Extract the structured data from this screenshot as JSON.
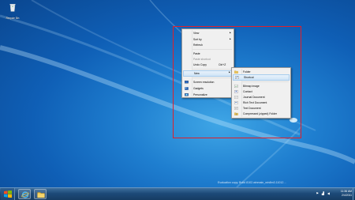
{
  "desktop": {
    "icons": [
      {
        "label": "Recycle Bin",
        "icon": "recycle-bin-icon"
      }
    ],
    "watermark": "Evaluation copy. Build 8102.winmain_win8m3.11012…"
  },
  "context_menu": {
    "items": [
      {
        "label": "View",
        "submenu": true
      },
      {
        "label": "Sort by",
        "submenu": true
      },
      {
        "label": "Refresh"
      },
      {
        "label": "Paste"
      },
      {
        "label": "Paste shortcut",
        "disabled": true
      },
      {
        "label": "Undo Copy",
        "shortcut": "Ctrl+Z"
      },
      {
        "label": "New",
        "submenu": true,
        "active": true
      },
      {
        "label": "Screen resolution",
        "icon": "screen-resolution-icon"
      },
      {
        "label": "Gadgets",
        "icon": "gadgets-icon"
      },
      {
        "label": "Personalize",
        "icon": "personalize-icon"
      }
    ]
  },
  "new_submenu": {
    "items": [
      {
        "label": "Folder",
        "icon": "folder-icon"
      },
      {
        "label": "Shortcut",
        "icon": "shortcut-icon",
        "active": true
      },
      {
        "label": "Bitmap image",
        "icon": "bitmap-image-icon"
      },
      {
        "label": "Contact",
        "icon": "contact-icon"
      },
      {
        "label": "Journal Document",
        "icon": "journal-document-icon"
      },
      {
        "label": "Rich Text Document",
        "icon": "rich-text-document-icon"
      },
      {
        "label": "Text Document",
        "icon": "text-document-icon"
      },
      {
        "label": "Compressed (zipped) Folder",
        "icon": "compressed-folder-icon"
      }
    ]
  },
  "taskbar": {
    "start_icon": "windows-logo-icon",
    "pinned": [
      {
        "name": "internet-explorer-icon"
      },
      {
        "name": "file-explorer-icon"
      }
    ],
    "tray": {
      "icons": [
        "action-center-flag-icon",
        "network-icon",
        "volume-icon"
      ]
    },
    "clock": {
      "time": "11:36 AM",
      "date": "2/4/2011"
    }
  },
  "colors": {
    "highlight_box": "#e0202a",
    "menu_bg": "#f0f0f0",
    "menu_active": "#cfe4f7"
  }
}
